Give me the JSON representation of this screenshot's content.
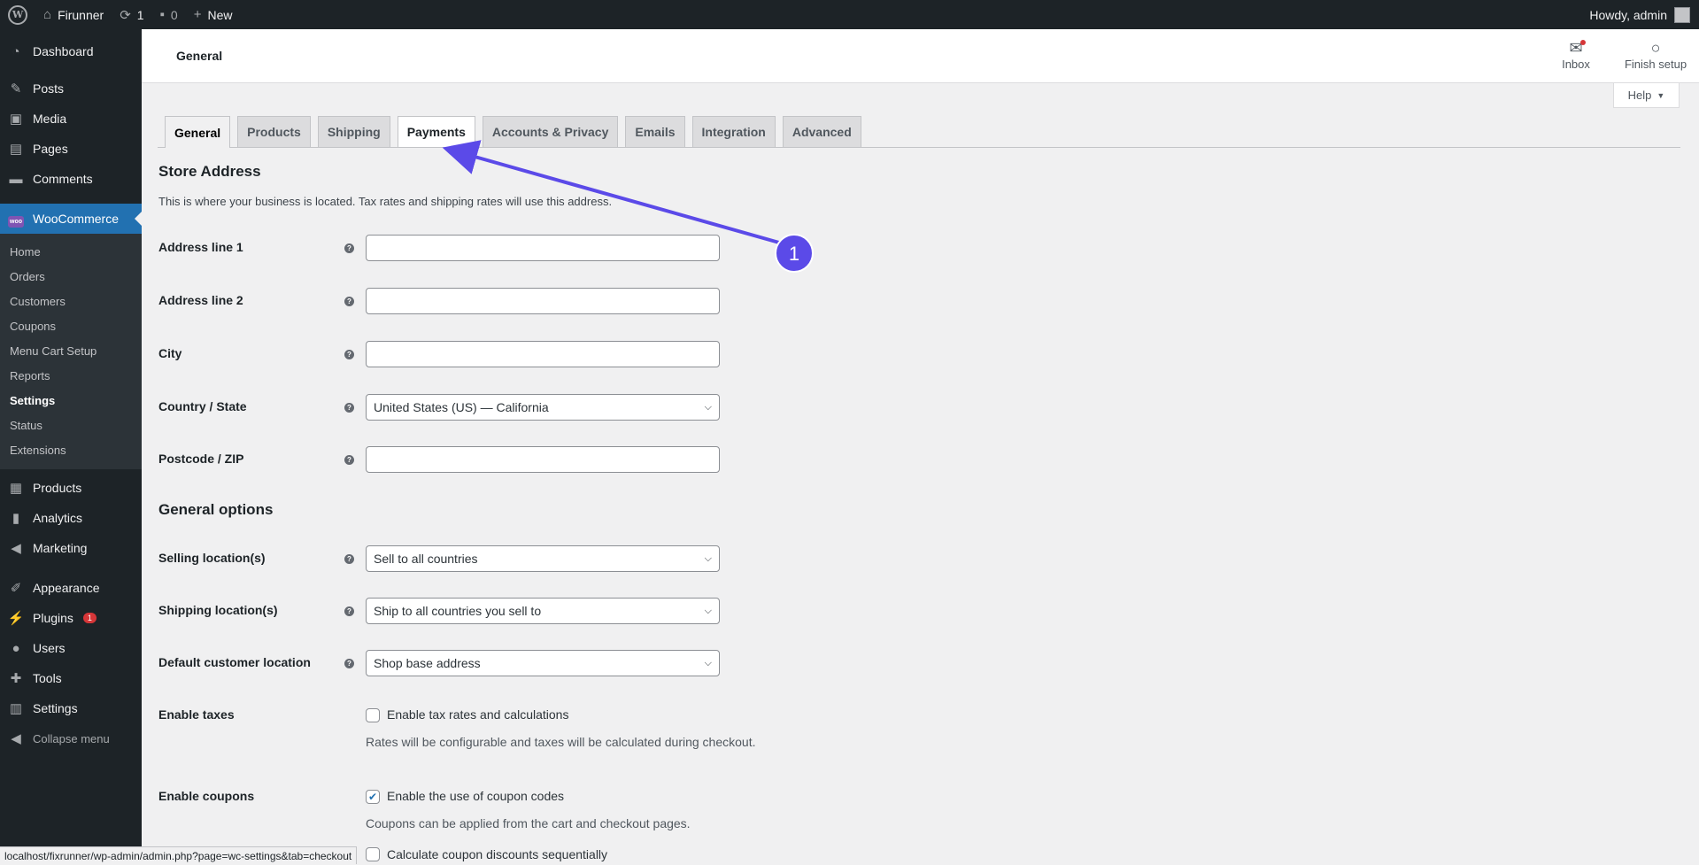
{
  "adminbar": {
    "site_name": "Firunner",
    "updates_count": "1",
    "comments_count": "0",
    "new_label": "New",
    "greeting": "Howdy, admin"
  },
  "sidebar": {
    "top_items": [
      {
        "label": "Dashboard",
        "icon": "dashboard-icon"
      },
      {
        "label": "Posts",
        "icon": "pin-icon"
      },
      {
        "label": "Media",
        "icon": "media-icon"
      },
      {
        "label": "Pages",
        "icon": "page-icon"
      },
      {
        "label": "Comments",
        "icon": "comment-icon"
      }
    ],
    "woocommerce": {
      "label": "WooCommerce",
      "logo_text": "woo"
    },
    "wc_submenu": [
      "Home",
      "Orders",
      "Customers",
      "Coupons",
      "Menu Cart Setup",
      "Reports",
      "Settings",
      "Status",
      "Extensions"
    ],
    "lower_items": [
      {
        "label": "Products",
        "icon": "box-icon"
      },
      {
        "label": "Analytics",
        "icon": "bar-chart-icon"
      },
      {
        "label": "Marketing",
        "icon": "megaphone-icon"
      }
    ],
    "bottom_items": [
      {
        "label": "Appearance",
        "icon": "brush-icon"
      },
      {
        "label": "Plugins",
        "icon": "plugin-icon",
        "badge": "1"
      },
      {
        "label": "Users",
        "icon": "user-icon"
      },
      {
        "label": "Tools",
        "icon": "wrench-icon"
      },
      {
        "label": "Settings",
        "icon": "settings-icon"
      },
      {
        "label": "Collapse menu",
        "icon": "collapse-icon"
      }
    ]
  },
  "header": {
    "title": "General",
    "inbox_label": "Inbox",
    "finish_setup_label": "Finish setup",
    "help_label": "Help"
  },
  "tabs": [
    "General",
    "Products",
    "Shipping",
    "Payments",
    "Accounts & Privacy",
    "Emails",
    "Integration",
    "Advanced"
  ],
  "store_address": {
    "heading": "Store Address",
    "description": "This is where your business is located. Tax rates and shipping rates will use this address.",
    "address1_label": "Address line 1",
    "address2_label": "Address line 2",
    "city_label": "City",
    "country_label": "Country / State",
    "country_value": "United States (US) — California",
    "postcode_label": "Postcode / ZIP"
  },
  "general_options": {
    "heading": "General options",
    "selling_label": "Selling location(s)",
    "selling_value": "Sell to all countries",
    "shipping_label": "Shipping location(s)",
    "shipping_value": "Ship to all countries you sell to",
    "default_loc_label": "Default customer location",
    "default_loc_value": "Shop base address",
    "taxes_label": "Enable taxes",
    "taxes_checkbox": "Enable tax rates and calculations",
    "taxes_checked": false,
    "taxes_note": "Rates will be configurable and taxes will be calculated during checkout.",
    "coupons_label": "Enable coupons",
    "coupons_checkbox": "Enable the use of coupon codes",
    "coupons_checked": true,
    "coupons_note": "Coupons can be applied from the cart and checkout pages.",
    "sequential_checkbox": "Calculate coupon discounts sequentially"
  },
  "status_url": "localhost/fixrunner/wp-admin/admin.php?page=wc-settings&tab=checkout",
  "annotation": {
    "step": "1",
    "color": "#5b4ae8"
  }
}
